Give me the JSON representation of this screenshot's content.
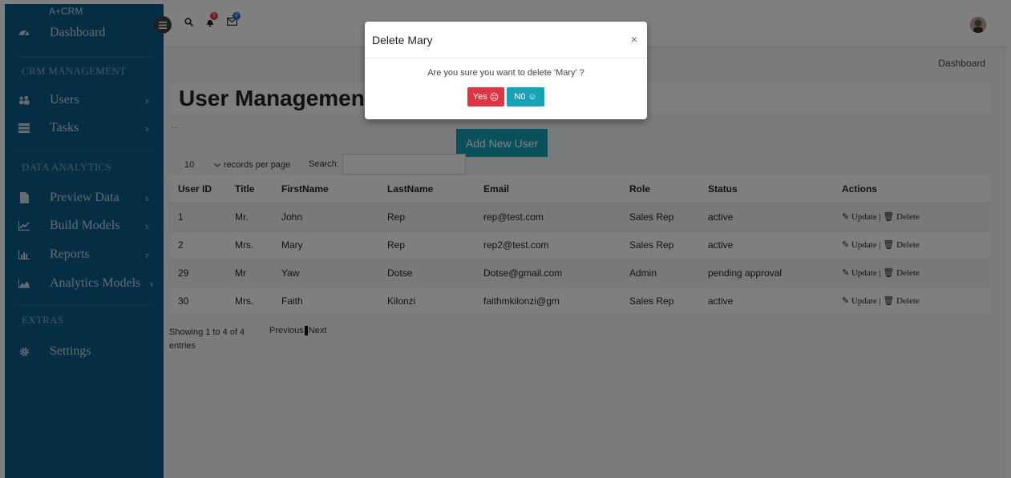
{
  "brand": "A+CRM",
  "sidebar": {
    "dashboard": "Dashboard",
    "sections": [
      "CRM MANAGEMENT",
      "DATA ANALYTICS",
      "EXTRAS"
    ],
    "items": [
      {
        "label": "Users",
        "icon": "users-icon"
      },
      {
        "label": "Tasks",
        "icon": "tasks-icon"
      },
      {
        "label": "Preview Data",
        "icon": "file-icon"
      },
      {
        "label": "Build Models",
        "icon": "line-chart-icon"
      },
      {
        "label": "Reports",
        "icon": "bar-chart-icon"
      },
      {
        "label": "Analytics Models",
        "icon": "area-chart-icon"
      },
      {
        "label": "Settings",
        "icon": "gear-icon"
      }
    ],
    "chevron": "›"
  },
  "topbar": {
    "notifications_badge": "5",
    "messages_badge": "0"
  },
  "breadcrumb": "Dashboard",
  "page": {
    "title": "User Managemen",
    "ellipsis": "...",
    "add_button": "Add New User",
    "records_value": "10",
    "records_label": "records per page",
    "search_label": "Search:",
    "showing": "Showing 1 to 4 of 4 entries",
    "pager_prev": "Previous",
    "pager_current": "1",
    "pager_next": "Next"
  },
  "table": {
    "headers": [
      "User ID",
      "Title",
      "FirstName",
      "LastName",
      "Email",
      "Role",
      "Status",
      "Actions"
    ],
    "rows": [
      [
        "1",
        "Mr.",
        "John",
        "Rep",
        "rep@test.com",
        "Sales Rep",
        "active",
        "✎ Update | 🗑 Delete"
      ],
      [
        "2",
        "Mrs.",
        "Mary",
        "Rep",
        "rep2@test.com",
        "Sales Rep",
        "active",
        "✎ Update | 🗑 Delete"
      ],
      [
        "29",
        "Mr",
        "Yaw",
        "Dotse",
        "Dotse@gmail.com",
        "Admin",
        "pending approval",
        "✎ Update | 🗑 Delete"
      ],
      [
        "30",
        "Mrs.",
        "Faith",
        "Kilonzi",
        "faithmkilonzi@gm",
        "Sales Rep",
        "active",
        "✎ Update | 🗑 Delete"
      ]
    ]
  },
  "modal": {
    "title": "Delete Mary",
    "close": "×",
    "message": "Are you sure you want to delete 'Mary' ?",
    "yes": "Yes",
    "yes_icon": "☹",
    "no": "N0",
    "no_icon": "☺"
  },
  "colors": {
    "sidebar": "#0b5c8a",
    "accent": "#17a2b8",
    "danger": "#dc3545"
  }
}
